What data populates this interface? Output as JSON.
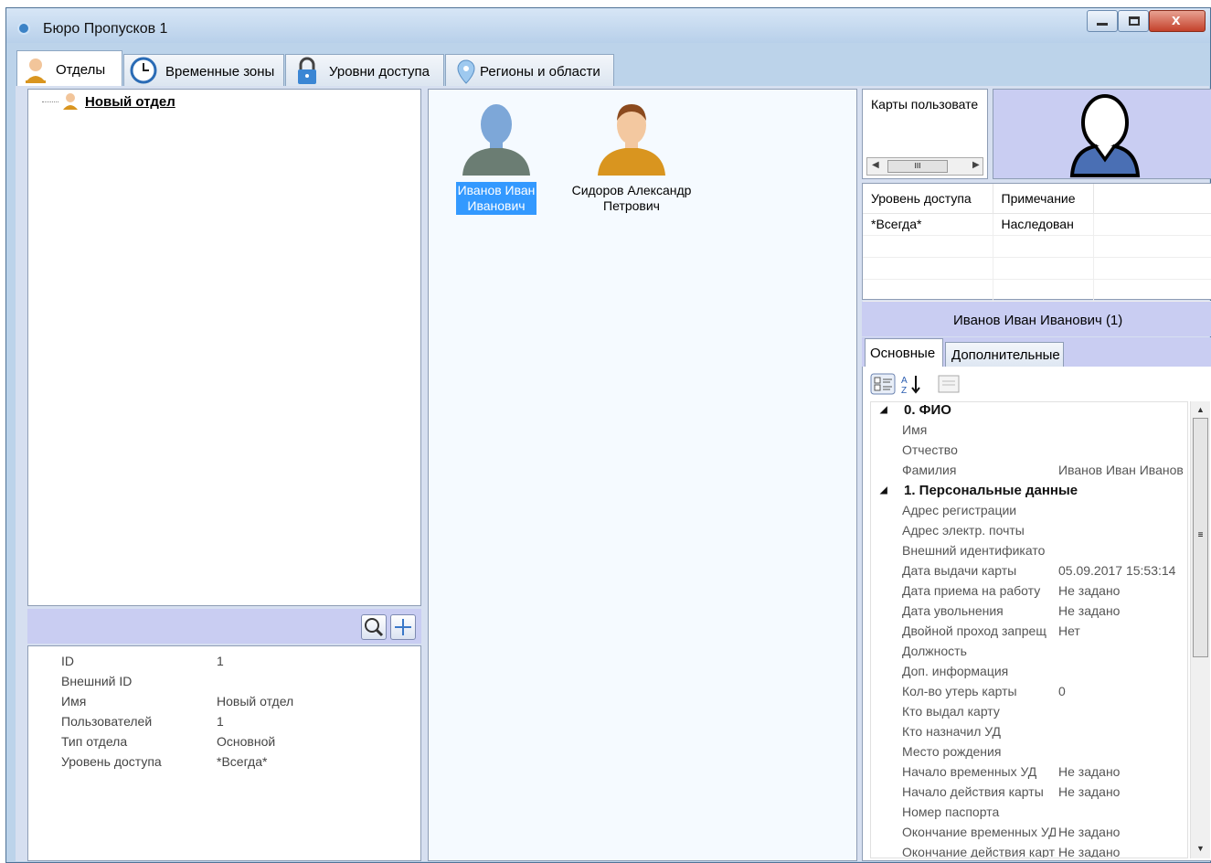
{
  "window": {
    "title": "Бюро Пропусков 1",
    "close_glyph": "x"
  },
  "tabs": [
    {
      "label": "Отделы",
      "icon": "user-icon"
    },
    {
      "label": "Временные зоны",
      "icon": "clock-icon"
    },
    {
      "label": "Уровни доступа",
      "icon": "lock-icon"
    },
    {
      "label": "Регионы и области",
      "icon": "location-pin-icon"
    }
  ],
  "tree": {
    "root_label": "Новый отдел"
  },
  "department_props": [
    {
      "key": "ID",
      "value": "1"
    },
    {
      "key": "Внешний ID",
      "value": ""
    },
    {
      "key": "Имя",
      "value": "Новый отдел"
    },
    {
      "key": "Пользователей",
      "value": "1"
    },
    {
      "key": "Тип отдела",
      "value": "Основной"
    },
    {
      "key": "Уровень доступа",
      "value": "*Всегда*"
    }
  ],
  "users": [
    {
      "name": "Иванов Иван Иванович",
      "line1": "Иванов Иван",
      "line2": "Иванович",
      "selected": true,
      "avatar_color": "#7da7d8"
    },
    {
      "name": "Сидоров Александр Петрович",
      "line1": "Сидоров Александр",
      "line2": "Петрович",
      "selected": false,
      "avatar_color": "#d9951f"
    }
  ],
  "cards": {
    "title": "Карты пользовате",
    "scroll_grip": "III"
  },
  "access_table": {
    "columns": [
      "Уровень доступа",
      "Примечание"
    ],
    "rows": [
      {
        "level": "*Всегда*",
        "note": "Наследован"
      }
    ]
  },
  "selected_user_header": "Иванов Иван Иванович (1)",
  "subtabs": {
    "active": "Основные",
    "inactive": "Дополнительные"
  },
  "property_grid": {
    "rows": [
      {
        "type": "cat",
        "label": "0. ФИО"
      },
      {
        "type": "prop",
        "key": "Имя",
        "value": ""
      },
      {
        "type": "prop",
        "key": "Отчество",
        "value": ""
      },
      {
        "type": "prop",
        "key": "Фамилия",
        "value": "Иванов Иван Иванов"
      },
      {
        "type": "cat",
        "label": "1. Персональные данные"
      },
      {
        "type": "prop",
        "key": "Адрес регистрации",
        "value": ""
      },
      {
        "type": "prop",
        "key": "Адрес электр. почты",
        "value": ""
      },
      {
        "type": "prop",
        "key": "Внешний идентификато",
        "value": ""
      },
      {
        "type": "prop",
        "key": "Дата выдачи карты",
        "value": "05.09.2017 15:53:14"
      },
      {
        "type": "prop",
        "key": "Дата приема на работу",
        "value": "Не задано"
      },
      {
        "type": "prop",
        "key": "Дата увольнения",
        "value": "Не задано"
      },
      {
        "type": "prop",
        "key": "Двойной проход запрещ",
        "value": "Нет"
      },
      {
        "type": "prop",
        "key": "Должность",
        "value": ""
      },
      {
        "type": "prop",
        "key": "Доп. информация",
        "value": ""
      },
      {
        "type": "prop",
        "key": "Кол-во утерь карты",
        "value": "0"
      },
      {
        "type": "prop",
        "key": "Кто выдал карту",
        "value": ""
      },
      {
        "type": "prop",
        "key": "Кто назначил УД",
        "value": ""
      },
      {
        "type": "prop",
        "key": "Место рождения",
        "value": ""
      },
      {
        "type": "prop",
        "key": "Начало временных УД",
        "value": "Не задано"
      },
      {
        "type": "prop",
        "key": "Начало действия карты",
        "value": "Не задано"
      },
      {
        "type": "prop",
        "key": "Номер паспорта",
        "value": ""
      },
      {
        "type": "prop",
        "key": "Окончание временных УД",
        "value": "Не задано"
      },
      {
        "type": "prop",
        "key": "Окончание действия карты",
        "value": "Не задано"
      }
    ]
  },
  "colors": {
    "panel_accent": "#c9cdf2",
    "selection": "#3399ff",
    "title_bar": "#c4d8ee"
  }
}
